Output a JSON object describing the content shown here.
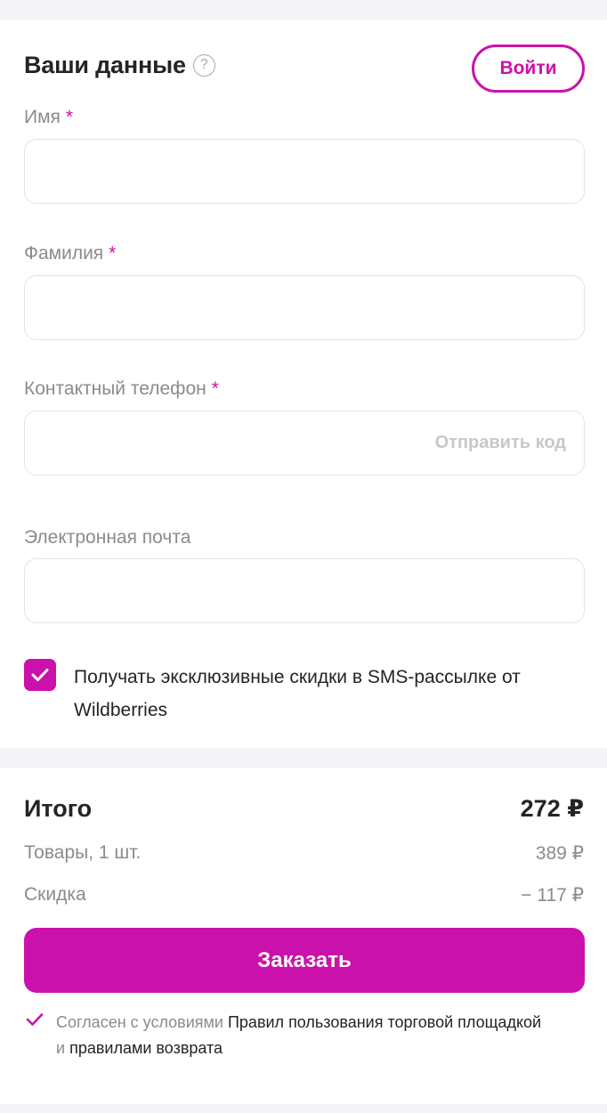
{
  "form": {
    "title": "Ваши данные",
    "help_icon": "?",
    "login_label": "Войти",
    "required_mark": "*",
    "fields": {
      "first_name": {
        "label": "Имя",
        "value": ""
      },
      "last_name": {
        "label": "Фамилия",
        "value": ""
      },
      "phone": {
        "label": "Контактный телефон",
        "value": "",
        "send_code": "Отправить код"
      },
      "email": {
        "label": "Электронная почта",
        "value": ""
      }
    },
    "sms_checkbox": {
      "checked": true,
      "label": "Получать эксклюзивные скидки в SMS-рассылке от Wildberries"
    }
  },
  "summary": {
    "total_label": "Итого",
    "total_value": "272 ₽",
    "goods_label": "Товары, 1 шт.",
    "goods_value": "389 ₽",
    "discount_label": "Скидка",
    "discount_value": "− 117 ₽",
    "order_button": "Заказать",
    "agreement": {
      "prefix": "Согласен с условиями",
      "link1": "Правил пользования торговой площадкой",
      "middle": "и",
      "link2": "правилами возврата"
    }
  },
  "colors": {
    "accent": "#cb11ab",
    "text": "#242424",
    "muted": "#8b8b8b",
    "background": "#f4f4f6"
  },
  "icons": [
    "help-icon",
    "checkbox-check-icon",
    "agree-check-icon"
  ]
}
